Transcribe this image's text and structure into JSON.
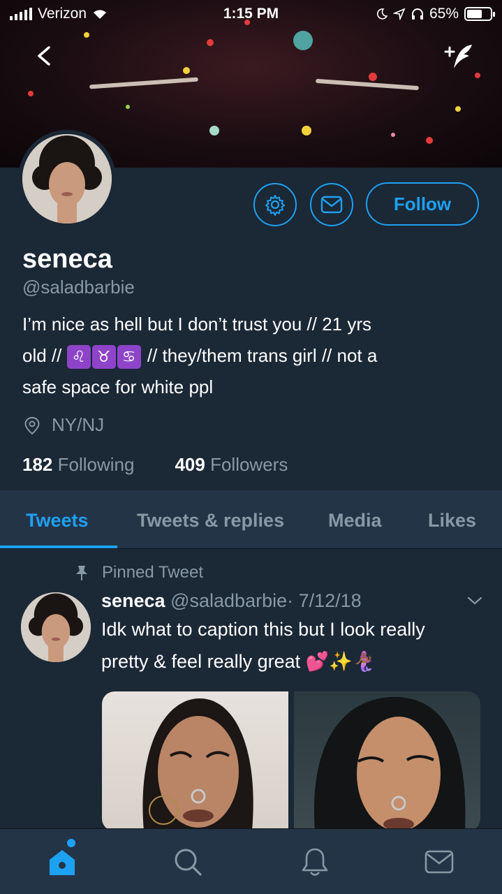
{
  "status_bar": {
    "carrier": "Verizon",
    "time": "1:15 PM",
    "battery": "65%",
    "battery_level": 0.65
  },
  "header": {
    "back_icon": "chevron-left-icon",
    "compose_icon": "compose-feather-icon"
  },
  "profile": {
    "name": "seneca",
    "handle": "@saladbarbie",
    "bio_line1": "I’m nice as hell but I don’t trust you // 21 yrs",
    "bio_line2_prefix": "old //",
    "zodiac": [
      "♌",
      "♉",
      "♋"
    ],
    "bio_line2_suffix": "// they/them trans girl // not a",
    "bio_line3": "safe space for white ppl",
    "location": "NY/NJ",
    "following_count": "182",
    "following_label": "Following",
    "followers_count": "409",
    "followers_label": "Followers",
    "follow_label": "Follow"
  },
  "tabs": [
    {
      "label": "Tweets",
      "active": true
    },
    {
      "label": "Tweets & replies",
      "active": false
    },
    {
      "label": "Media",
      "active": false
    },
    {
      "label": "Likes",
      "active": false
    }
  ],
  "tweet": {
    "pinned_label": "Pinned Tweet",
    "author": "seneca",
    "handle": "@saladbarbie",
    "date": "· 7/12/18",
    "text_line1": "Idk what to caption this but I look really",
    "text_line2": "pretty & feel really great 💕✨🧜🏾‍♀️"
  },
  "bottom_nav": [
    {
      "icon": "home-icon",
      "active": true
    },
    {
      "icon": "search-icon",
      "active": false
    },
    {
      "icon": "notifications-bell-icon",
      "active": false
    },
    {
      "icon": "messages-envelope-icon",
      "active": false
    }
  ],
  "colors": {
    "accent": "#1da1f2",
    "background": "#1b2836",
    "bar": "#243447",
    "muted": "#8899a6"
  }
}
